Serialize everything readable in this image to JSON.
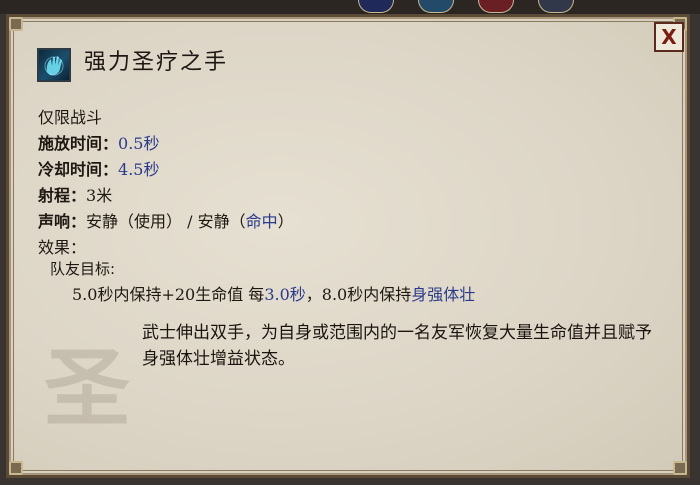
{
  "ability": {
    "name": "强力圣疗之手",
    "restriction": "仅限战斗",
    "cast_time_label": "施放时间：",
    "cast_time_value": "0.5秒",
    "cooldown_label": "冷却时间：",
    "cooldown_value": "4.5秒",
    "range_label": "射程：",
    "range_value": "3米",
    "sound_label": "声响：",
    "sound_use": "安静（使用）",
    "sound_sep": " / ",
    "sound_hit_pre": "安静（",
    "sound_hit_blue": "命中",
    "sound_hit_post": "）",
    "effects_label": "效果：",
    "target_label": "队友目标:",
    "effect_part1": "5.0秒内保持+20生命值 每",
    "effect_interval": "3.0秒",
    "effect_part2": "，8.0秒内保持",
    "effect_status": "身强体壮",
    "watermark_char": "圣",
    "description": "武士伸出双手，为自身或范围内的一名友军恢复大量生命值并且赋予身强体壮增益状态。"
  },
  "close_label": "X",
  "colors": {
    "highlight": "#2a3a8a",
    "panel_bg": "#ddd6c7",
    "border": "#5b4a36"
  },
  "icons": {
    "ability": "healing-hand-icon",
    "close": "close-icon"
  }
}
